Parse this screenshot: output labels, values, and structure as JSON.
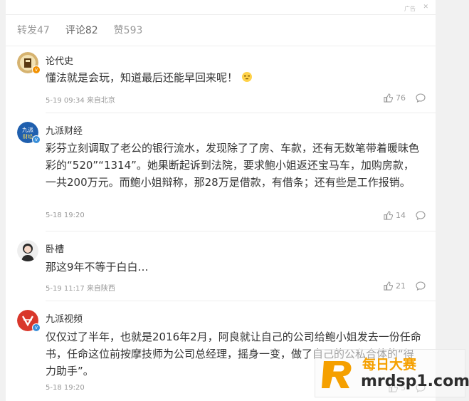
{
  "ad": {
    "label": "广告",
    "close": "✕"
  },
  "tabs": [
    {
      "label": "转发47"
    },
    {
      "label": "评论82"
    },
    {
      "label": "赞593"
    }
  ],
  "comments": [
    {
      "username": "论代史",
      "text": "懂法就是会玩，知道最后还能早回来呢！",
      "meta": "5-19 09:34 来自北京",
      "likes": "76"
    },
    {
      "username": "九派财经",
      "text": "彩芬立刻调取了老公的银行流水，发现除了了房、车款，还有无数笔带着暖昧色彩的“520”“1314”。她果断起诉到法院，要求鲍小姐返还宝马车，加购房款，一共200万元。而鲍小姐辩称，那28万是借款，有借条；还有些是工作报销。",
      "meta": "5-18 19:20",
      "likes": "14"
    },
    {
      "username": "卧槽",
      "text": "那这9年不等于白白…",
      "meta": "5-19 11:17 来自陕西",
      "likes": "21"
    },
    {
      "username": "九派视频",
      "text": "仅仅过了半年，也就是2016年2月，阿良就让自己的公司给鲍小姐发去一份任命书，任命这位前按摩技师为公司总经理，摇身一变，做了自己的公私合体的“得力助手”。",
      "meta": "5-18 19:20",
      "likes": "5"
    }
  ],
  "watermark": {
    "title": "每日大赛",
    "url": "mrdsp1.com"
  }
}
